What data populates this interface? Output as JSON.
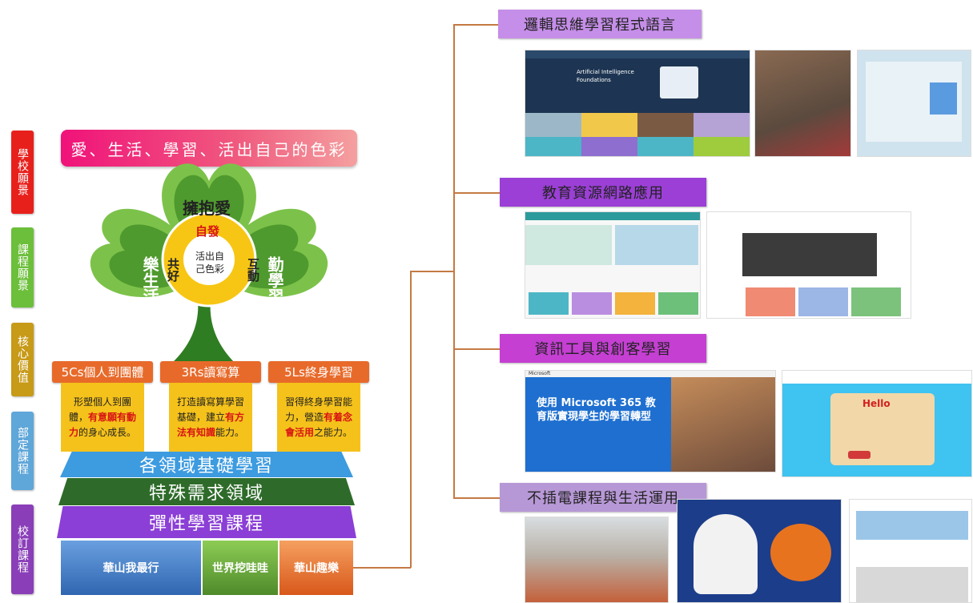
{
  "left_tags": [
    {
      "text": "學校願景",
      "color": "#e8201c"
    },
    {
      "text": "課程願景",
      "color": "#6cbf3b"
    },
    {
      "text": "核心價值",
      "color": "#c79a18"
    },
    {
      "text": "部定課程",
      "color": "#5fa6d9"
    },
    {
      "text": "校訂課程",
      "color": "#8a3fb8"
    }
  ],
  "banner": "愛、生活、學習、活出自己的色彩",
  "flower": {
    "top": "擁抱愛",
    "left": "樂生活",
    "right": "勤學習",
    "center": "活出自己色彩",
    "ring_top": "自發",
    "ring_left": "共好",
    "ring_right": "互動"
  },
  "categories": [
    {
      "title": "5Cs個人到團體",
      "note_parts": [
        "形塑個人到團體，",
        "有意願有動力",
        "的身心成長。"
      ]
    },
    {
      "title": "3Rs讀寫算",
      "note_parts": [
        "打造讀寫算學習基礎，建立",
        "有方法有知識",
        "能力。"
      ]
    },
    {
      "title": "5Ls終身學習",
      "note_parts": [
        "習得終身學習能力，營造",
        "有着念會活用",
        "之能力。"
      ]
    }
  ],
  "layers": [
    {
      "text": "各領域基礎學習",
      "color": "#3d9be0"
    },
    {
      "text": "特殊需求領域",
      "color": "#2e6b2a"
    },
    {
      "text": "彈性學習課程",
      "color": "#8b3fd6"
    }
  ],
  "bottom": [
    {
      "text": "華山我最行",
      "color": "#4a7fc0"
    },
    {
      "text": "世界挖哇哇",
      "color": "#6aa83a"
    },
    {
      "text": "華山趣樂",
      "color": "#e8742a"
    }
  ],
  "right_labels": [
    {
      "text": "邏輯思維學習程式語言",
      "color": "#c58ee8"
    },
    {
      "text": "教育資源網路應用",
      "color": "#9b3fd6"
    },
    {
      "text": "資訊工具與創客學習",
      "color": "#c43fd2"
    },
    {
      "text": "不插電課程與生活運用",
      "color": "#b798d6"
    }
  ],
  "screens": {
    "ai_title": "Artificial Intelligence Foundations",
    "ms_title": "使用 Microsoft 365 教育版實現學生的學習轉型",
    "ms_brand": "Microsoft",
    "game_title": "Hello"
  }
}
